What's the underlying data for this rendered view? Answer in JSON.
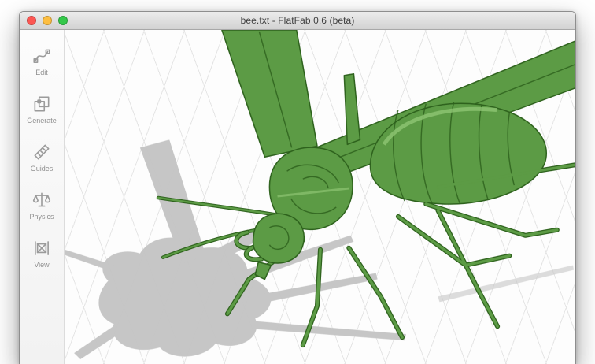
{
  "window": {
    "title": "bee.txt - FlatFab 0.6 (beta)"
  },
  "traffic_lights": {
    "close": "close",
    "minimize": "minimize",
    "zoom": "zoom"
  },
  "sidebar": {
    "items": [
      {
        "label": "Edit",
        "icon": "spline-icon"
      },
      {
        "label": "Generate",
        "icon": "generate-squares-icon"
      },
      {
        "label": "Guides",
        "icon": "ruler-icon"
      },
      {
        "label": "Physics",
        "icon": "balance-scale-icon"
      },
      {
        "label": "View",
        "icon": "viewport-frame-icon"
      }
    ]
  },
  "canvas": {
    "content": "3D planar-section model of a bee with ground shadow on perspective grid"
  },
  "colors": {
    "model_green": "#5C9B45",
    "model_green_dark": "#2E621D",
    "model_green_light": "#8FC573",
    "shadow_gray": "#C3C3C3",
    "grid_line": "#E5E5E5",
    "canvas_bg": "#FDFDFD",
    "traffic_close": "#FC5652",
    "traffic_minimize": "#FDBE41",
    "traffic_zoom": "#34C84A"
  }
}
